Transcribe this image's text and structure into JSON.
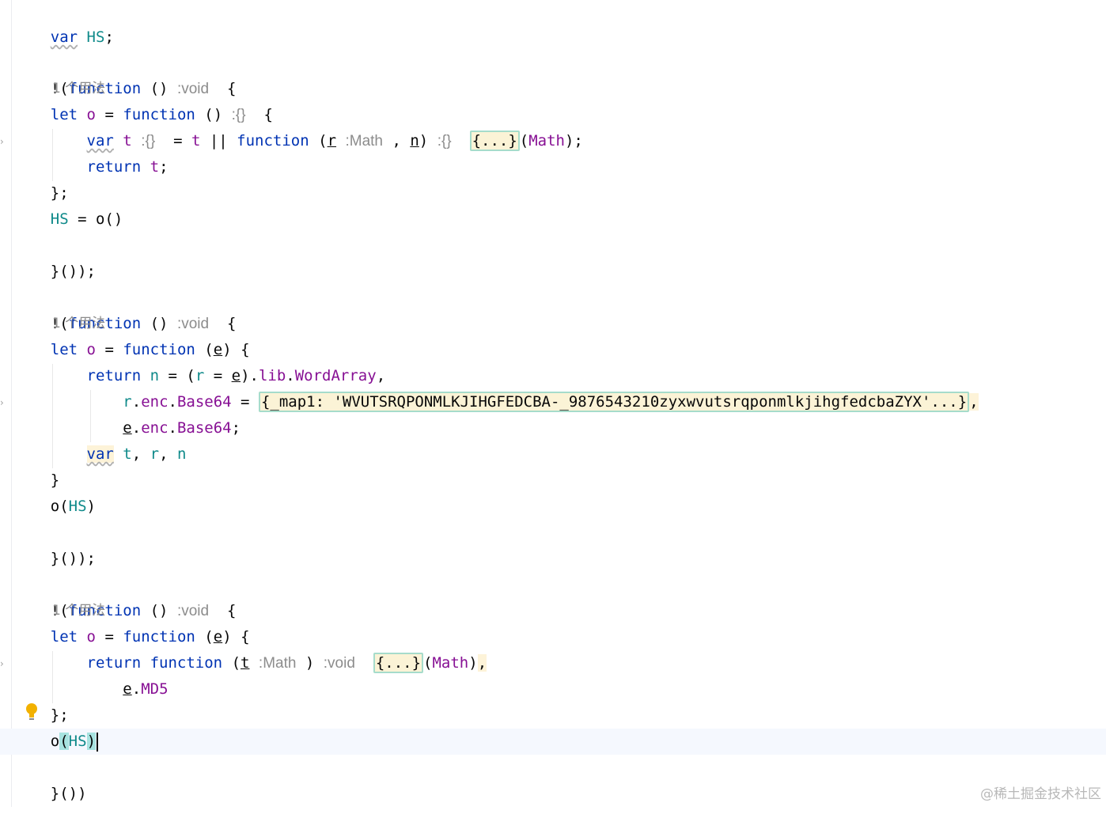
{
  "editor": {
    "usage_hint": "1 个用法",
    "watermark": "@稀土掘金技术社区",
    "lines": {
      "l1_var": "var",
      "l1_hs": "HS",
      "l1_semi": ";",
      "iife_open_1": "!(",
      "func_kw": "function",
      "paren_pair": " () ",
      "void_hint": ":void",
      "brace_open": "{",
      "let_kw": "let",
      "o": "o",
      "eq": " = ",
      "obj_hint": ":{}",
      "var_kw": "var",
      "t": "t",
      "or": " || ",
      "r": "r",
      "n": "n",
      "e": "e",
      "math_hint": ":Math",
      "fold_dots": "{...}",
      "math_arg": "Math",
      "return_kw": "return",
      "close_semi": "};",
      "hs_assign_o": "o()",
      "iife_close": "}());",
      "iife_close_last": "}())",
      "lib": "lib",
      "wordarray": "WordArray",
      "enc": "enc",
      "base64": "Base64",
      "map_fold": "{_map1: 'WVUTSRQPONMLKJIHGFEDCBA-_9876543210zyxwvutsrqponmlkjihgfedcbaZYX'...}",
      "md5": "MD5",
      "close_brace": "}",
      "o_call": "o(",
      "hs_arg": "HS",
      "o_close": ")"
    }
  }
}
